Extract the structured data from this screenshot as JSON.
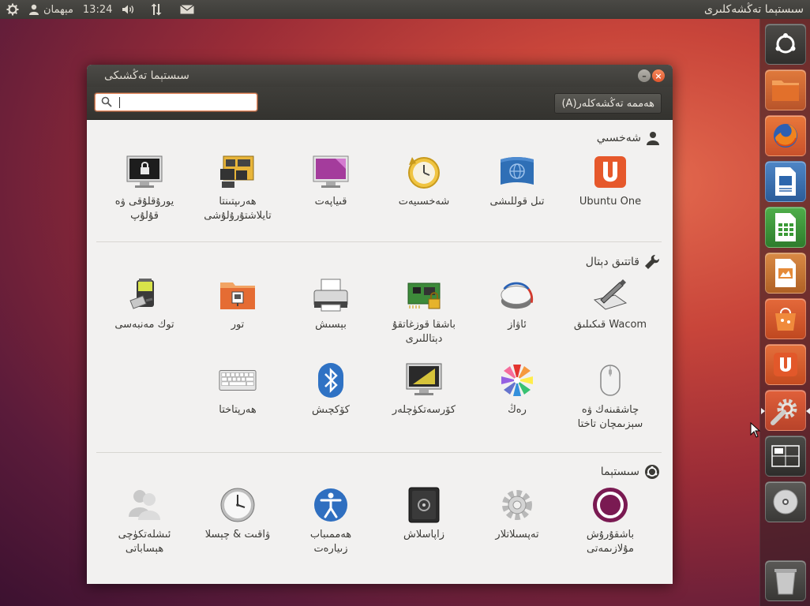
{
  "top_panel": {
    "app_title": "سىستېما تەڭشەكلىرى",
    "user_name": "مېھمان",
    "clock": "13:24",
    "icons": [
      "settings-gear-icon",
      "user-icon",
      "volume-icon",
      "network-icon",
      "mail-icon"
    ]
  },
  "window": {
    "title": "سىستېما تەڭشىكى",
    "all_settings_label": "ھەممە تەڭشەكلەر(A)",
    "search_value": "",
    "search_placeholder": ""
  },
  "sections": [
    {
      "title": "شەخسىي",
      "icon": "person-icon",
      "items": [
        {
          "label": "Ubuntu One",
          "icon": "ubuntu-one-icon"
        },
        {
          "label": "تىل قوللىشى",
          "icon": "language-support-icon"
        },
        {
          "label": "شەخسىيەت",
          "icon": "privacy-icon"
        },
        {
          "label": "قىياپەت",
          "icon": "appearance-icon"
        },
        {
          "label": "ھەرىپتىنتا\nتايلاشتۇرۇلۇشى",
          "icon": "keyboard-layout-icon"
        },
        {
          "label": "يورۇقلۇقى ۋە\nقۇلۇپ",
          "icon": "brightness-lock-icon"
        }
      ]
    },
    {
      "title": "قاتتىق دېتال",
      "icon": "wrench-icon",
      "items": [
        {
          "label": "Wacom قىكىلىق",
          "icon": "wacom-tablet-icon"
        },
        {
          "label": "ئاۋاز",
          "icon": "sound-icon"
        },
        {
          "label": "باشقا قوزغاتقۇ\nدېتاللىرى",
          "icon": "additional-drivers-icon"
        },
        {
          "label": "بېسىش",
          "icon": "printer-icon"
        },
        {
          "label": "تور",
          "icon": "network-folder-icon"
        },
        {
          "label": "توك مەنبەسى",
          "icon": "power-icon"
        },
        {
          "label": "چاشقىنەك ۋە\nسېزىمچان تاختا",
          "icon": "mouse-icon"
        },
        {
          "label": "رەڭ",
          "icon": "color-icon"
        },
        {
          "label": "كۆرسەتكۈچلەر",
          "icon": "displays-icon"
        },
        {
          "label": "كۆكچىش",
          "icon": "bluetooth-icon"
        },
        {
          "label": "ھەرپتاختا",
          "icon": "keyboard-icon"
        }
      ]
    },
    {
      "title": "سىستېما",
      "icon": "system-icon",
      "items": [
        {
          "label": "باشقۇرۇش\nمۇلازىمەتى",
          "icon": "management-service-icon"
        },
        {
          "label": "تەپسىلاتلار",
          "icon": "details-gear-icon"
        },
        {
          "label": "زاپاسلاش",
          "icon": "backup-safe-icon"
        },
        {
          "label": "ھەممىباب\nزىيارەت",
          "icon": "universal-access-icon"
        },
        {
          "label": "ۋاقىت & چېسلا",
          "icon": "clock-icon"
        },
        {
          "label": "ئىشلەتكۈچى\nھېساباتى",
          "icon": "user-accounts-icon"
        }
      ]
    }
  ],
  "launcher": [
    {
      "name": "dash-home-icon"
    },
    {
      "name": "files-folder-icon"
    },
    {
      "name": "firefox-icon"
    },
    {
      "name": "libreoffice-writer-icon"
    },
    {
      "name": "libreoffice-calc-icon"
    },
    {
      "name": "libreoffice-impress-icon"
    },
    {
      "name": "software-center-icon"
    },
    {
      "name": "ubuntu-one-launcher-icon"
    },
    {
      "name": "system-settings-launcher-icon",
      "active": true
    },
    {
      "name": "workspace-switcher-icon"
    },
    {
      "name": "cd-drive-icon"
    },
    {
      "name": "trash-icon"
    }
  ],
  "colors": {
    "accent_orange": "#e0552d",
    "panel_dark": "#3c3b37",
    "window_bg": "#f2f1f0"
  }
}
